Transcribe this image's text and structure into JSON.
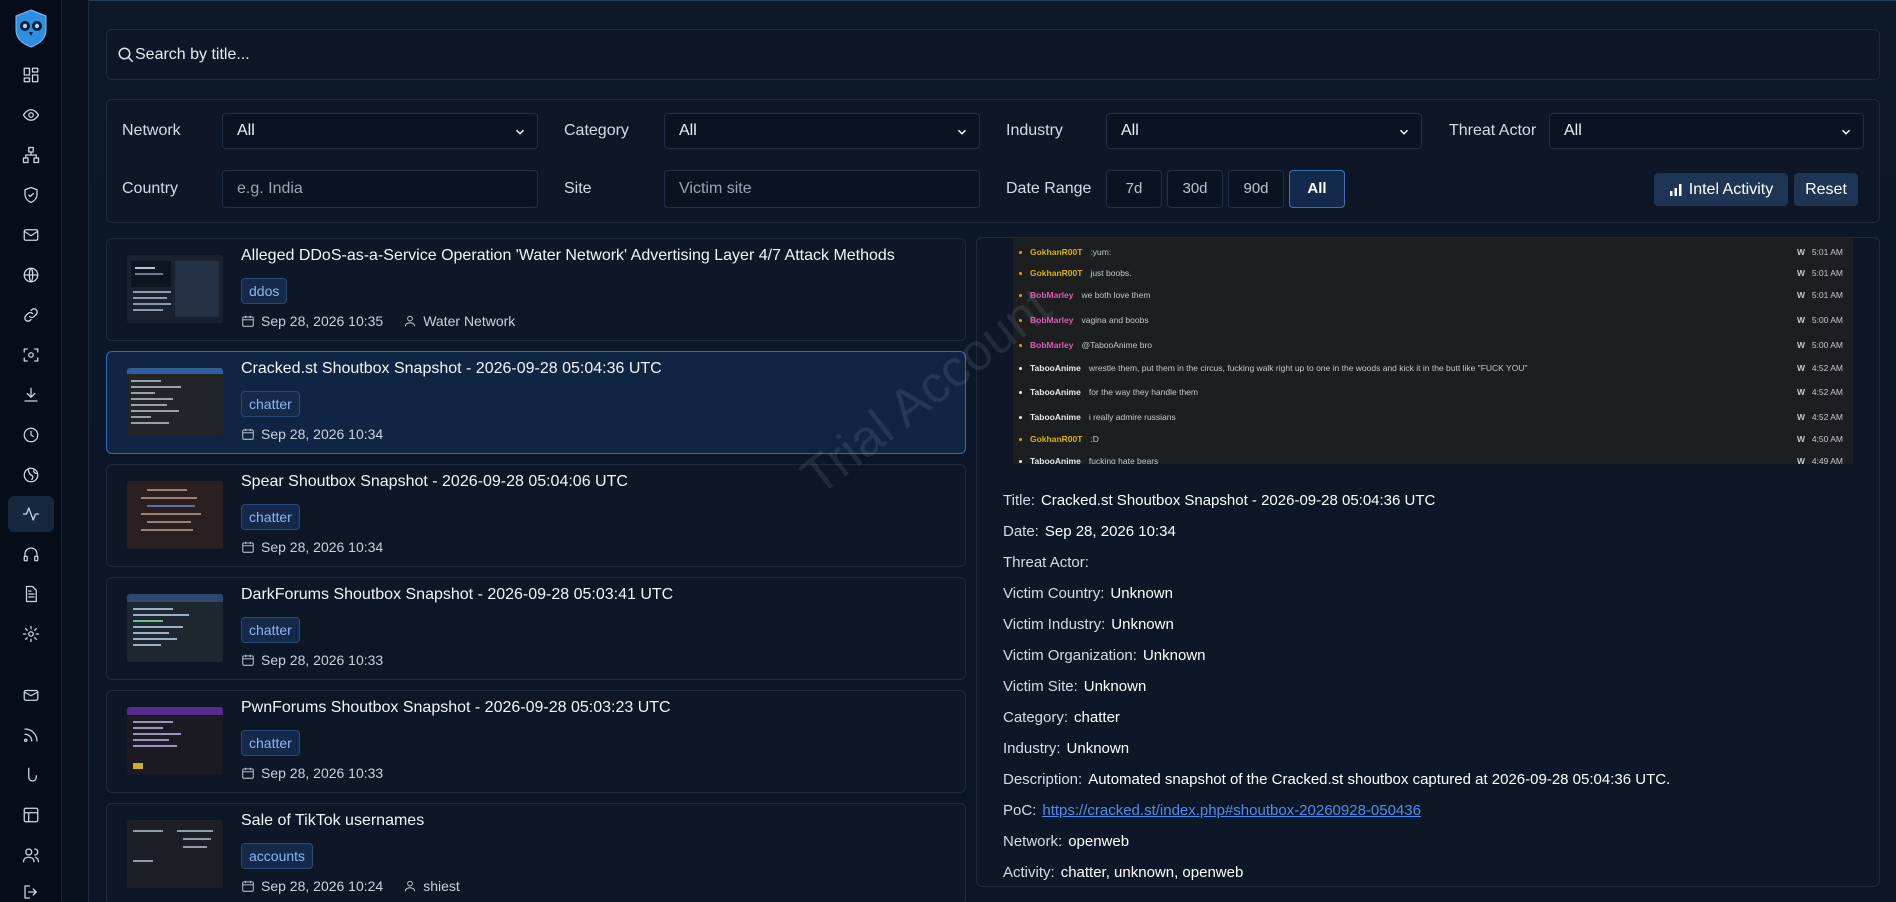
{
  "search": {
    "placeholder": "Search by title..."
  },
  "filters": {
    "network_label": "Network",
    "network_value": "All",
    "category_label": "Category",
    "category_value": "All",
    "industry_label": "Industry",
    "industry_value": "All",
    "threat_actor_label": "Threat Actor",
    "threat_actor_value": "All",
    "country_label": "Country",
    "country_placeholder": "e.g. India",
    "site_label": "Site",
    "site_placeholder": "Victim site",
    "date_range_label": "Date Range",
    "ranges": [
      "7d",
      "30d",
      "90d",
      "All"
    ],
    "active_range": "All",
    "intel_activity_label": "Intel Activity",
    "reset_label": "Reset"
  },
  "posts": [
    {
      "title": "Alleged DDoS-as-a-Service Operation 'Water Network' Advertising Layer 4/7 Attack Methods",
      "tag": "ddos",
      "date": "Sep 28, 2026 10:35",
      "actor": "Water Network"
    },
    {
      "title": "Cracked.st Shoutbox Snapshot - 2026-09-28 05:04:36 UTC",
      "tag": "chatter",
      "date": "Sep 28, 2026 10:34",
      "actor": ""
    },
    {
      "title": "Spear Shoutbox Snapshot - 2026-09-28 05:04:06 UTC",
      "tag": "chatter",
      "date": "Sep 28, 2026 10:34",
      "actor": ""
    },
    {
      "title": "DarkForums Shoutbox Snapshot - 2026-09-28 05:03:41 UTC",
      "tag": "chatter",
      "date": "Sep 28, 2026 10:33",
      "actor": ""
    },
    {
      "title": "PwnForums Shoutbox Snapshot - 2026-09-28 05:03:23 UTC",
      "tag": "chatter",
      "date": "Sep 28, 2026 10:33",
      "actor": ""
    },
    {
      "title": "Sale of TikTok usernames",
      "tag": "accounts",
      "date": "Sep 28, 2026 10:24",
      "actor": "shiest"
    }
  ],
  "screenshot_chat": [
    {
      "user": "GokhanR00T",
      "color": "#d7b400",
      "msg": ":yum:",
      "time": "5:01 AM"
    },
    {
      "user": "GokhanR00T",
      "color": "#d7b400",
      "msg": "just boobs.",
      "time": "5:01 AM"
    },
    {
      "user": "BobMarley",
      "color": "#e05ab0",
      "msg": "we both love them",
      "time": "5:01 AM"
    },
    {
      "user": "BobMarley",
      "color": "#e05ab0",
      "msg": "vagina and boobs",
      "time": "5:00 AM"
    },
    {
      "user": "BobMarley",
      "color": "#e05ab0",
      "msg": "@TabooAnime bro",
      "time": "5:00 AM"
    },
    {
      "user": "TabooAnime",
      "color": "#e8e8e8",
      "msg": "wrestle them, put them in the circus, fucking walk right up to one in the woods and kick it in the butt like \"FUCK YOU\"",
      "time": "4:52 AM"
    },
    {
      "user": "TabooAnime",
      "color": "#e8e8e8",
      "msg": "for the way they handle them",
      "time": "4:52 AM"
    },
    {
      "user": "TabooAnime",
      "color": "#e8e8e8",
      "msg": "i really admire russians",
      "time": "4:52 AM"
    },
    {
      "user": "GokhanR00T",
      "color": "#d7b400",
      "msg": ":D",
      "time": "4:50 AM"
    },
    {
      "user": "TabooAnime",
      "color": "#e8e8e8",
      "msg": "fucking hate bears",
      "time": "4:49 AM"
    }
  ],
  "detail": {
    "title_label": "Title:",
    "title": "Cracked.st Shoutbox Snapshot - 2026-09-28 05:04:36 UTC",
    "date_label": "Date:",
    "date": "Sep 28, 2026 10:34",
    "threat_actor_label": "Threat Actor:",
    "threat_actor": "",
    "victim_country_label": "Victim Country:",
    "victim_country": "Unknown",
    "victim_industry_label": "Victim Industry:",
    "victim_industry": "Unknown",
    "victim_org_label": "Victim Organization:",
    "victim_org": "Unknown",
    "victim_site_label": "Victim Site:",
    "victim_site": "Unknown",
    "category_label": "Category:",
    "category": "chatter",
    "industry_label": "Industry:",
    "industry": "Unknown",
    "description_label": "Description:",
    "description": "Automated snapshot of the Cracked.st shoutbox captured at 2026-09-28 05:04:36 UTC.",
    "poc_label": "PoC:",
    "poc": "https://cracked.st/index.php#shoutbox-20260928-050436",
    "network_label": "Network:",
    "network": "openweb",
    "activity_label": "Activity:",
    "activity": "chatter, unknown, openweb"
  },
  "watermark": "Trial Account"
}
